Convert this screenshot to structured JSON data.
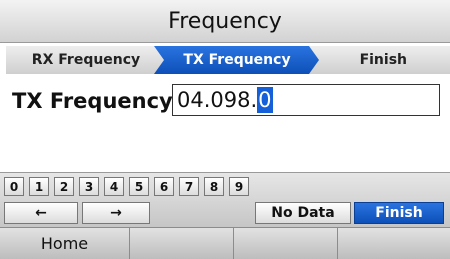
{
  "title": "Frequency",
  "steps": {
    "rx": "RX Frequency",
    "tx": "TX Frequency",
    "finish": "Finish"
  },
  "entry": {
    "label": "TX Frequency:",
    "value_prefix": "04.098.",
    "value_selected": "0"
  },
  "keypad": {
    "digits": [
      "0",
      "1",
      "2",
      "3",
      "4",
      "5",
      "6",
      "7",
      "8",
      "9"
    ],
    "left_arrow": "←",
    "right_arrow": "→",
    "no_data": "No Data",
    "finish": "Finish"
  },
  "menu": {
    "items": [
      "Home",
      "",
      "",
      ""
    ]
  },
  "colors": {
    "accent": "#1560d8",
    "chrome": "#d2d2d2"
  }
}
